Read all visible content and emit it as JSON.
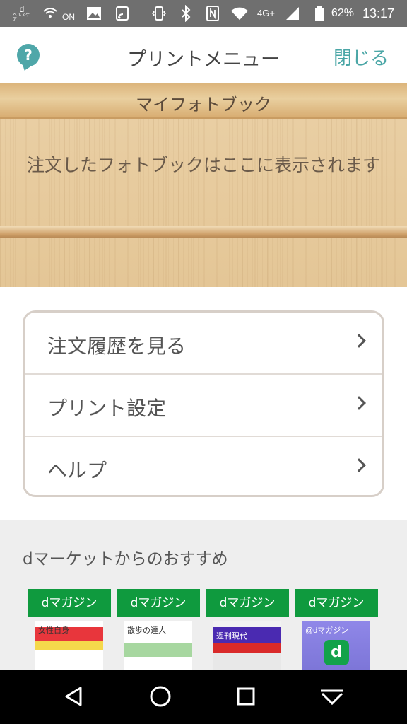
{
  "status_bar": {
    "icons_left": [
      "d-health-icon",
      "wifi-call-icon",
      "image-icon",
      "cast-icon"
    ],
    "small_d": "d",
    "small_vertical": "ヘルスケア",
    "on_label": "ON",
    "network": "4G+",
    "battery": "62%",
    "time": "13:17"
  },
  "header": {
    "help_icon": "?",
    "title": "プリントメニュー",
    "close_label": "閉じる"
  },
  "shelf": {
    "title": "マイフォトブック",
    "empty_message": "注文したフォトブックはここに表示されます"
  },
  "menu": {
    "items": [
      {
        "label": "注文履歴を見る"
      },
      {
        "label": "プリント設定"
      },
      {
        "label": "ヘルプ"
      }
    ]
  },
  "recommendations": {
    "title": "dマーケットからのおすすめ",
    "items": [
      {
        "badge": "dマガジン",
        "cover_text": "女性自身"
      },
      {
        "badge": "dマガジン",
        "cover_text": "散歩の達人"
      },
      {
        "badge": "dマガジン",
        "cover_text": "週刊現代"
      },
      {
        "badge": "dマガジン",
        "cover_text": "@dマガジン"
      }
    ],
    "logo_letter": "d"
  },
  "colors": {
    "accent": "#4aa6a6",
    "badge_green": "#0f9a3e",
    "status_bar": "#6f6f6f",
    "nav_bar": "#000000"
  }
}
